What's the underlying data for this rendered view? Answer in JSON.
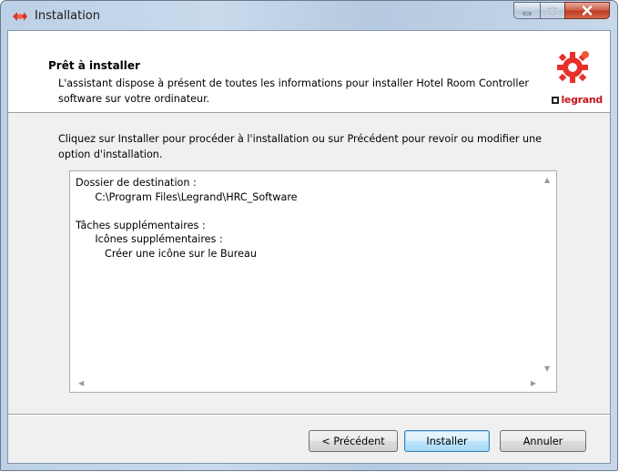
{
  "window": {
    "title": "Installation",
    "app_icon": "installer-gear-icon",
    "controls": [
      "minimize-icon",
      "maximize-icon",
      "close-icon"
    ]
  },
  "header": {
    "title": "Prêt à installer",
    "subtitle": "L'assistant dispose à présent de toutes les informations pour installer Hotel Room Controller software sur votre ordinateur.",
    "logo_icon": "legrand-gear-logo",
    "brand": "legrand"
  },
  "instructions": "Cliquez sur Installer pour procéder à l'installation ou sur Précédent pour revoir ou modifier une option d'installation.",
  "summary": {
    "text": "Dossier de destination :\n      C:\\Program Files\\Legrand\\HRC_Software\n\nTâches supplémentaires :\n      Icônes supplémentaires :\n         Créer une icône sur le Bureau",
    "scroll_icons": [
      "scroll-up-icon",
      "scroll-down-icon",
      "scroll-left-icon",
      "scroll-right-icon"
    ]
  },
  "buttons": {
    "back": "< Précédent",
    "install": "Installer",
    "cancel": "Annuler"
  },
  "colors": {
    "brand_red": "#c2171f",
    "logo_red": "#e8302a",
    "close_red": "#c94a31",
    "primary_border": "#3c7fb1"
  }
}
